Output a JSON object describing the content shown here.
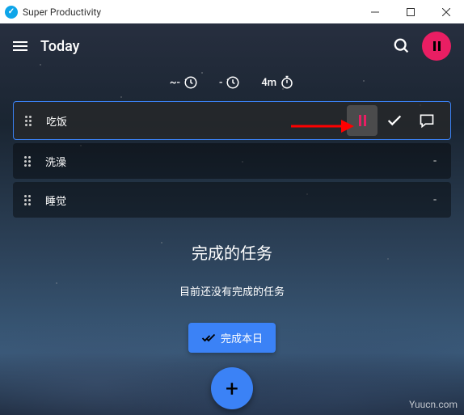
{
  "window": {
    "title": "Super Productivity"
  },
  "header": {
    "title": "Today"
  },
  "timers": {
    "tilde": "~-",
    "minus": "-",
    "stopwatch_value": "4m"
  },
  "tasks": [
    {
      "name": "吃饭",
      "active": true
    },
    {
      "name": "洗澡",
      "active": false
    },
    {
      "name": "睡觉",
      "active": false
    }
  ],
  "completed": {
    "title": "完成的任务",
    "empty_msg": "目前还没有完成的任务",
    "button_label": "完成本日"
  },
  "watermark": "Yuucn.com",
  "icons": {
    "plus": "+",
    "dash": "-"
  }
}
